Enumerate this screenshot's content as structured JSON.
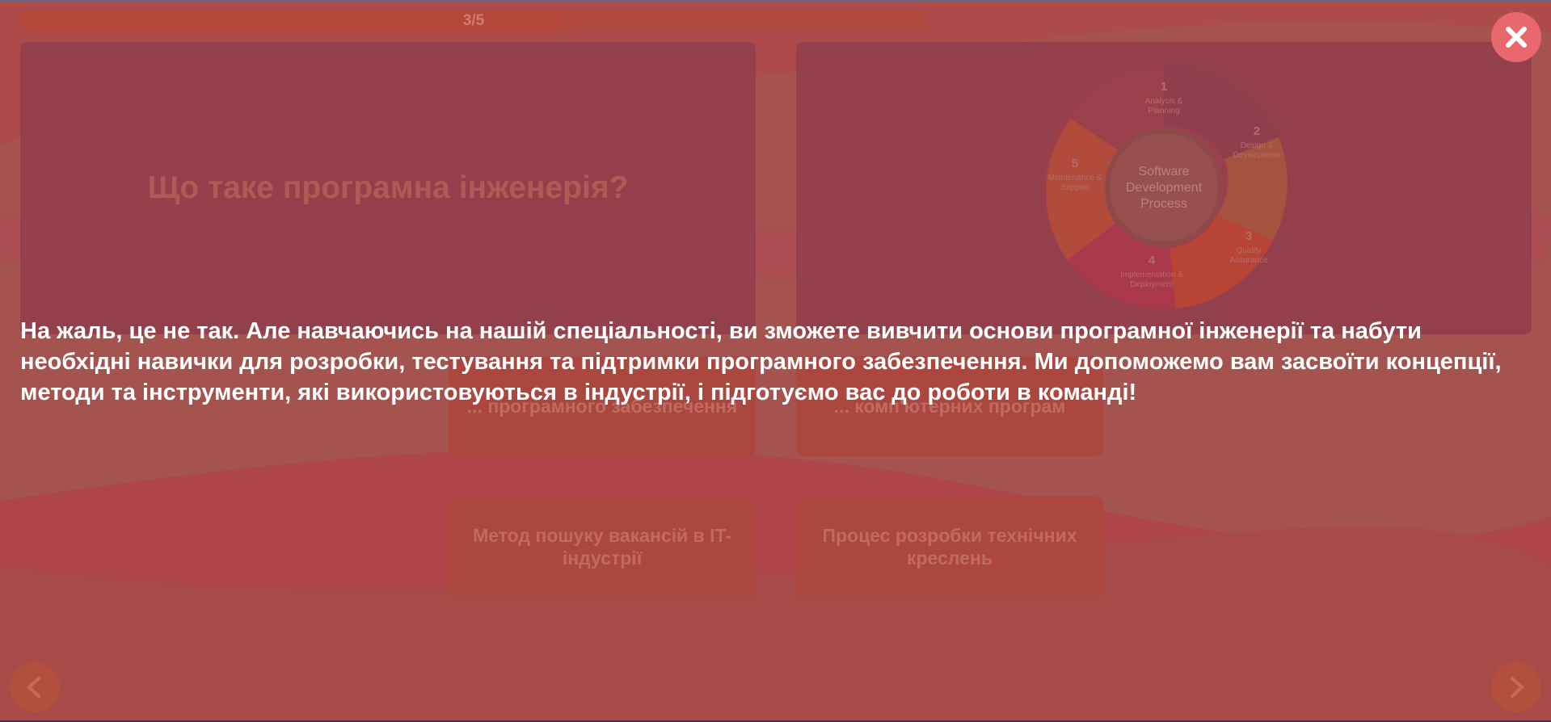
{
  "progress": {
    "label": "3/5",
    "fraction": 0.6
  },
  "question": {
    "title": "Що таке програмна інженерія?"
  },
  "diagram": {
    "center_lines": [
      "Software",
      "Development",
      "Process"
    ],
    "steps": [
      {
        "num": "1",
        "lines": [
          "Analysis &",
          "Planning"
        ]
      },
      {
        "num": "2",
        "lines": [
          "Design &",
          "Development"
        ]
      },
      {
        "num": "3",
        "lines": [
          "Quality",
          "Assurance"
        ]
      },
      {
        "num": "4",
        "lines": [
          "Implementation &",
          "Deployment"
        ]
      },
      {
        "num": "5",
        "lines": [
          "Maintenance &",
          "Support"
        ]
      }
    ]
  },
  "answers": [
    {
      "label": "... програмного забезпечення"
    },
    {
      "label": "... комп'ютерних програм"
    },
    {
      "label": "Метод пошуку вакансій в IT-індустрії"
    },
    {
      "label": "Процес розробки технічних креслень"
    }
  ],
  "feedback": {
    "text": "На жаль, це не так. Але навчаючись на нашій спеціальності, ви зможете вивчити основи програмної інженерії та набути необхідні навички для розробки, тестування та підтримки програмного забезпечення. Ми допоможемо вам засвоїти концепції, методи та інструменти, які використовуються в індустрії, і підготуємо вас до роботи в команді!"
  },
  "icons": {
    "close": "close-icon",
    "prev": "chevron-left-icon",
    "next": "chevron-right-icon"
  },
  "colors": {
    "background": "#a5534e",
    "close_button": "#e8686e",
    "card": "#943f4c"
  }
}
